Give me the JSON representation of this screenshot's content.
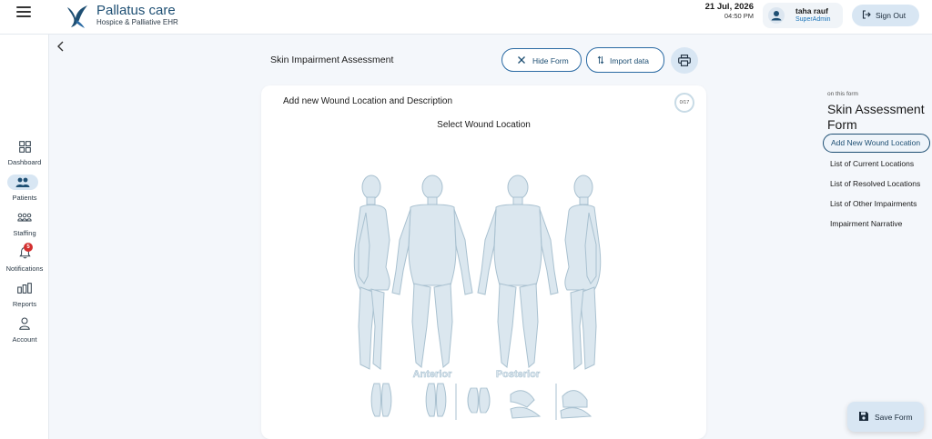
{
  "app": {
    "name": "Pallatus care",
    "subtitle": "Hospice & Palliative EHR"
  },
  "header": {
    "date": "21 Jul, 2026",
    "time": "04:50 PM",
    "user_name": "taha rauf",
    "user_role": "SuperAdmin",
    "sign_out_label": "Sign Out"
  },
  "sidebar": {
    "items": [
      {
        "label": "Dashboard",
        "icon": "dashboard-icon",
        "active": false
      },
      {
        "label": "Patients",
        "icon": "patients-icon",
        "active": true
      },
      {
        "label": "Staffing",
        "icon": "staffing-icon",
        "active": false
      },
      {
        "label": "Notifications",
        "icon": "bell-icon",
        "active": false,
        "badge": "5"
      },
      {
        "label": "Reports",
        "icon": "reports-icon",
        "active": false
      },
      {
        "label": "Account",
        "icon": "account-icon",
        "active": false
      }
    ]
  },
  "form": {
    "title": "Skin Impairment Assessment",
    "hide_form_label": "Hide Form",
    "import_data_label": "Import data",
    "card_title": "Add new Wound Location and Description",
    "step_progress": "0/17",
    "select_location_label": "Select Wound Location",
    "anterior_label": "Anterior",
    "posterior_label": "Posterior"
  },
  "toc": {
    "caption": "on this form",
    "title": "Skin Assessment Form",
    "items": [
      "Add New Wound Location",
      "List of Current Locations",
      "List of Resolved Locations",
      "List of Other Impairments",
      "Impairment Narrative"
    ]
  },
  "actions": {
    "save_label": "Save Form"
  },
  "colors": {
    "brand": "#1e4f73",
    "accent_light": "#d8e6f3",
    "badge": "#d32f2f",
    "body_map": "#dbe7ef"
  }
}
